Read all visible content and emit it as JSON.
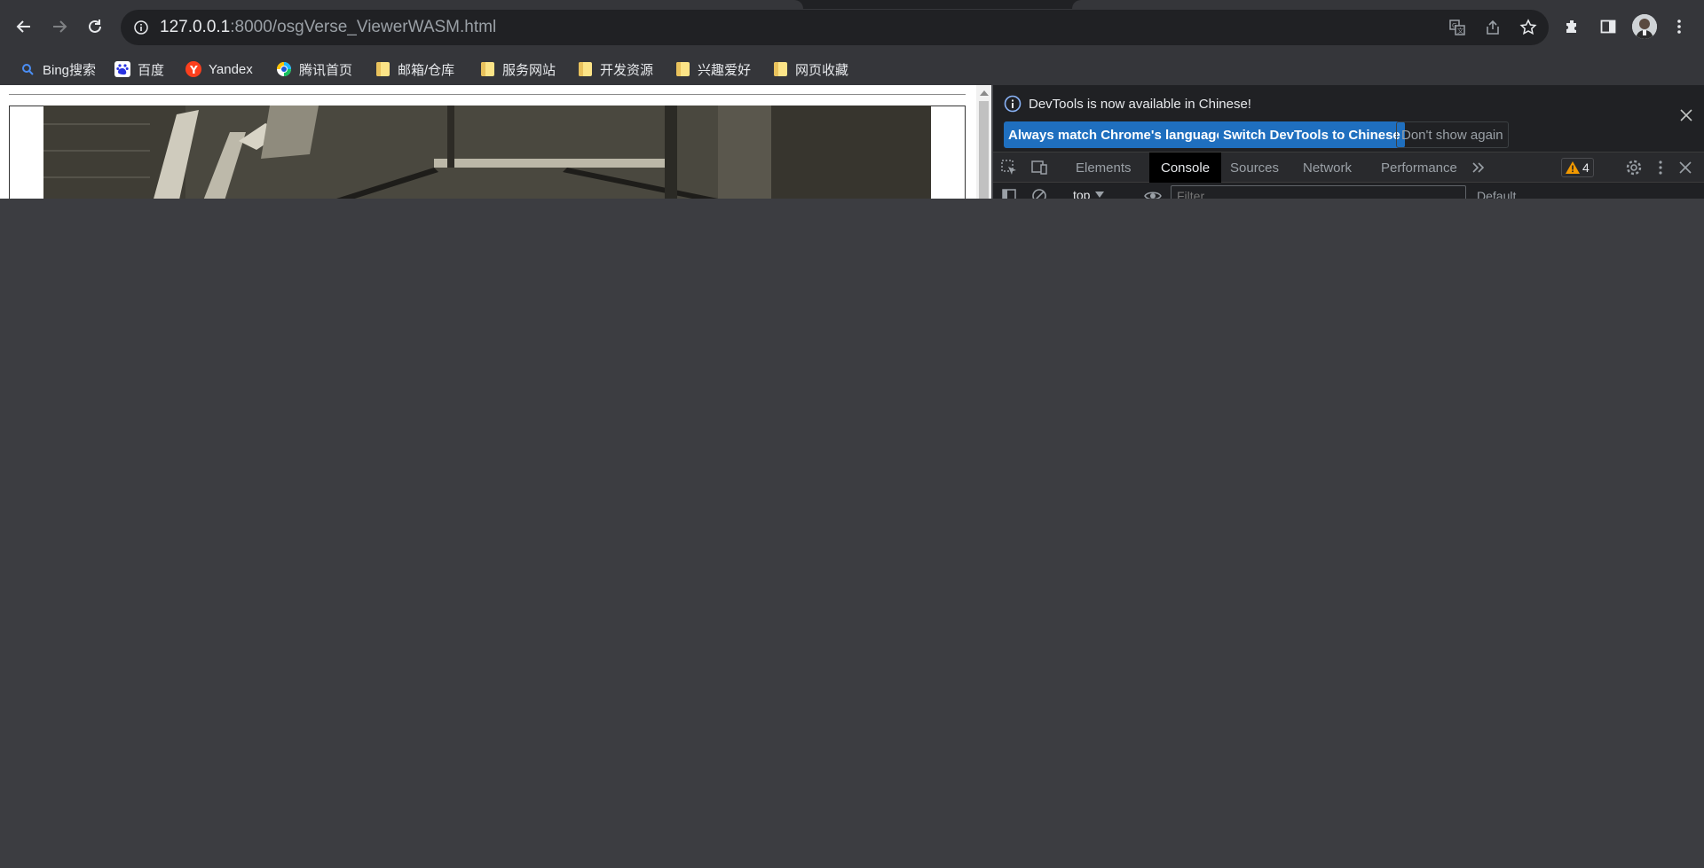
{
  "browser": {
    "url_host": "127.0.0.1",
    "url_rest": ":8000/osgVerse_ViewerWASM.html"
  },
  "bookmarks": [
    {
      "label": "Bing搜索",
      "icon": "bing-search-icon"
    },
    {
      "label": "百度",
      "icon": "baidu-icon"
    },
    {
      "label": "Yandex",
      "icon": "yandex-icon"
    },
    {
      "label": "腾讯首页",
      "icon": "tencent-icon"
    },
    {
      "label": "邮箱/仓库",
      "icon": "folder-icon"
    },
    {
      "label": "服务网站",
      "icon": "folder-icon"
    },
    {
      "label": "开发资源",
      "icon": "folder-icon"
    },
    {
      "label": "兴趣爱好",
      "icon": "folder-icon"
    },
    {
      "label": "网页收藏",
      "icon": "folder-icon"
    }
  ],
  "devtools": {
    "infobar": {
      "message": "DevTools is now available in Chinese!",
      "btn_match": "Always match Chrome's language",
      "btn_switch": "Switch DevTools to Chinese",
      "btn_dismiss": "Don't show again"
    },
    "tabs": [
      "Elements",
      "Console",
      "Sources",
      "Network",
      "Performance"
    ],
    "active_tab": "Console",
    "warning_count": "4",
    "console": {
      "context": "top",
      "filter_placeholder": "Filter",
      "levels": "Default"
    }
  },
  "colors": {
    "primary_button": "#1f6fbf",
    "warning": "#f29900"
  }
}
